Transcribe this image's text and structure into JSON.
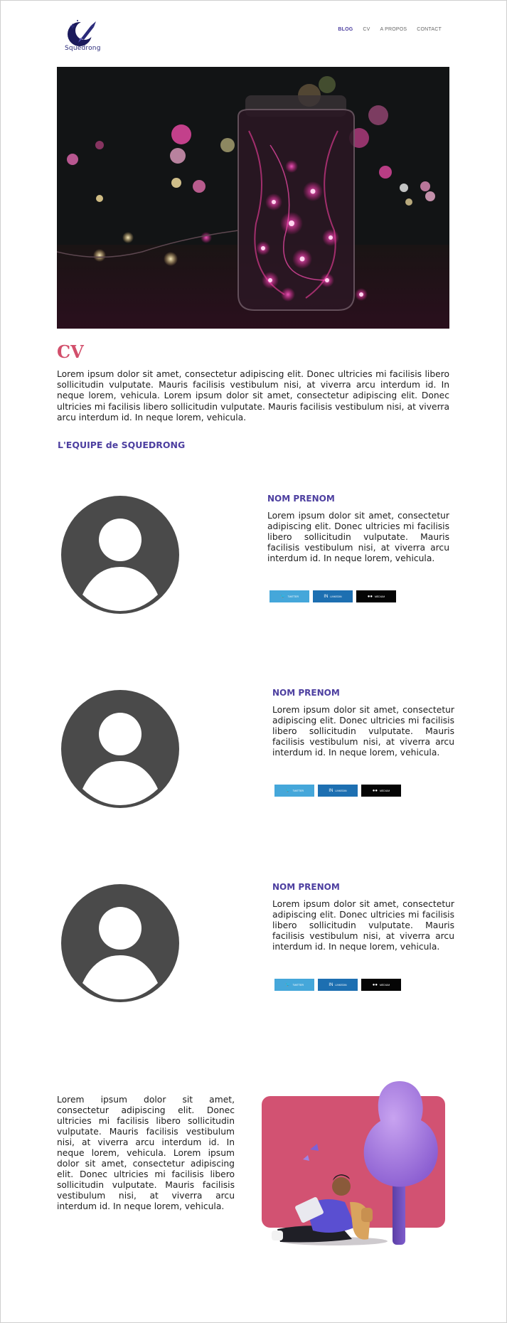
{
  "brand": {
    "name": "Squedrong",
    "logo_icon": "rocket-moon-icon"
  },
  "nav": {
    "items": [
      {
        "label": "BLOG",
        "active": true
      },
      {
        "label": "CV",
        "active": false
      },
      {
        "label": "A PROPOS",
        "active": false
      },
      {
        "label": "CONTACT",
        "active": false
      }
    ]
  },
  "hero": {
    "image": "pink-fairy-lights-jar-photo"
  },
  "cv": {
    "title": "CV",
    "intro": "Lorem ipsum dolor sit amet, consectetur adipiscing elit. Donec ultricies mi facilisis libero sollicitudin vulputate. Mauris facilisis vestibulum nisi, at viverra arcu interdum id. In neque lorem, vehicula. Lorem ipsum dolor sit amet, consectetur adipiscing elit. Donec ultricies mi facilisis libero sollicitudin vulputate. Mauris facilisis vestibulum nisi, at viverra arcu interdum id. In neque lorem, vehicula."
  },
  "team": {
    "title": "L'EQUIPE de SQUEDRONG",
    "members": [
      {
        "name": "NOM PRENOM",
        "bio": "Lorem ipsum dolor sit amet, consectetur adipiscing elit. Donec ultricies mi facilisis libero sollicitudin vulputate. Mauris facilisis vestibulum nisi, at viverra arcu interdum id. In neque lorem, vehicula.",
        "avatar": "user-avatar-placeholder"
      },
      {
        "name": "NOM PRENOM",
        "bio": "Lorem ipsum dolor sit amet, consectetur adipiscing elit. Donec ultricies mi facilisis libero sollicitudin vulputate. Mauris facilisis vestibulum nisi, at viverra arcu interdum id. In neque lorem, vehicula.",
        "avatar": "user-avatar-placeholder"
      },
      {
        "name": "NOM PRENOM",
        "bio": "Lorem ipsum dolor sit amet, consectetur adipiscing elit. Donec ultricies mi facilisis libero sollicitudin vulputate. Mauris facilisis vestibulum nisi, at viverra arcu interdum id. In neque lorem, vehicula.",
        "avatar": "user-avatar-placeholder"
      }
    ],
    "socials": [
      {
        "label": "TWITTER",
        "icon": "twitter-icon",
        "color": "#45a7da"
      },
      {
        "label": "LINKEDIN",
        "icon": "linkedin-icon",
        "color": "#1d6fb1"
      },
      {
        "label": "MEDIUM",
        "icon": "medium-icon",
        "color": "#050505"
      }
    ]
  },
  "outro": {
    "text": "Lorem ipsum dolor sit amet, consectetur adipiscing elit. Donec ultricies mi facilisis libero sollicitudin vulputate. Mauris facilisis vestibulum nisi, at viverra arcu interdum id. In neque lorem, vehicula. Lorem ipsum dolor sit amet, consectetur adipiscing elit. Donec ultricies mi facilisis libero sollicitudin vulputate. Mauris facilisis vestibulum nisi, at viverra arcu interdum id. In neque lorem, vehicula.",
    "illustration": "person-reading-under-tree-illustration"
  },
  "colors": {
    "accent": "#4d3fa0",
    "cv_title": "#d24f6b",
    "avatar": "#4a4a4a",
    "illustration_bg": "#d25272"
  }
}
